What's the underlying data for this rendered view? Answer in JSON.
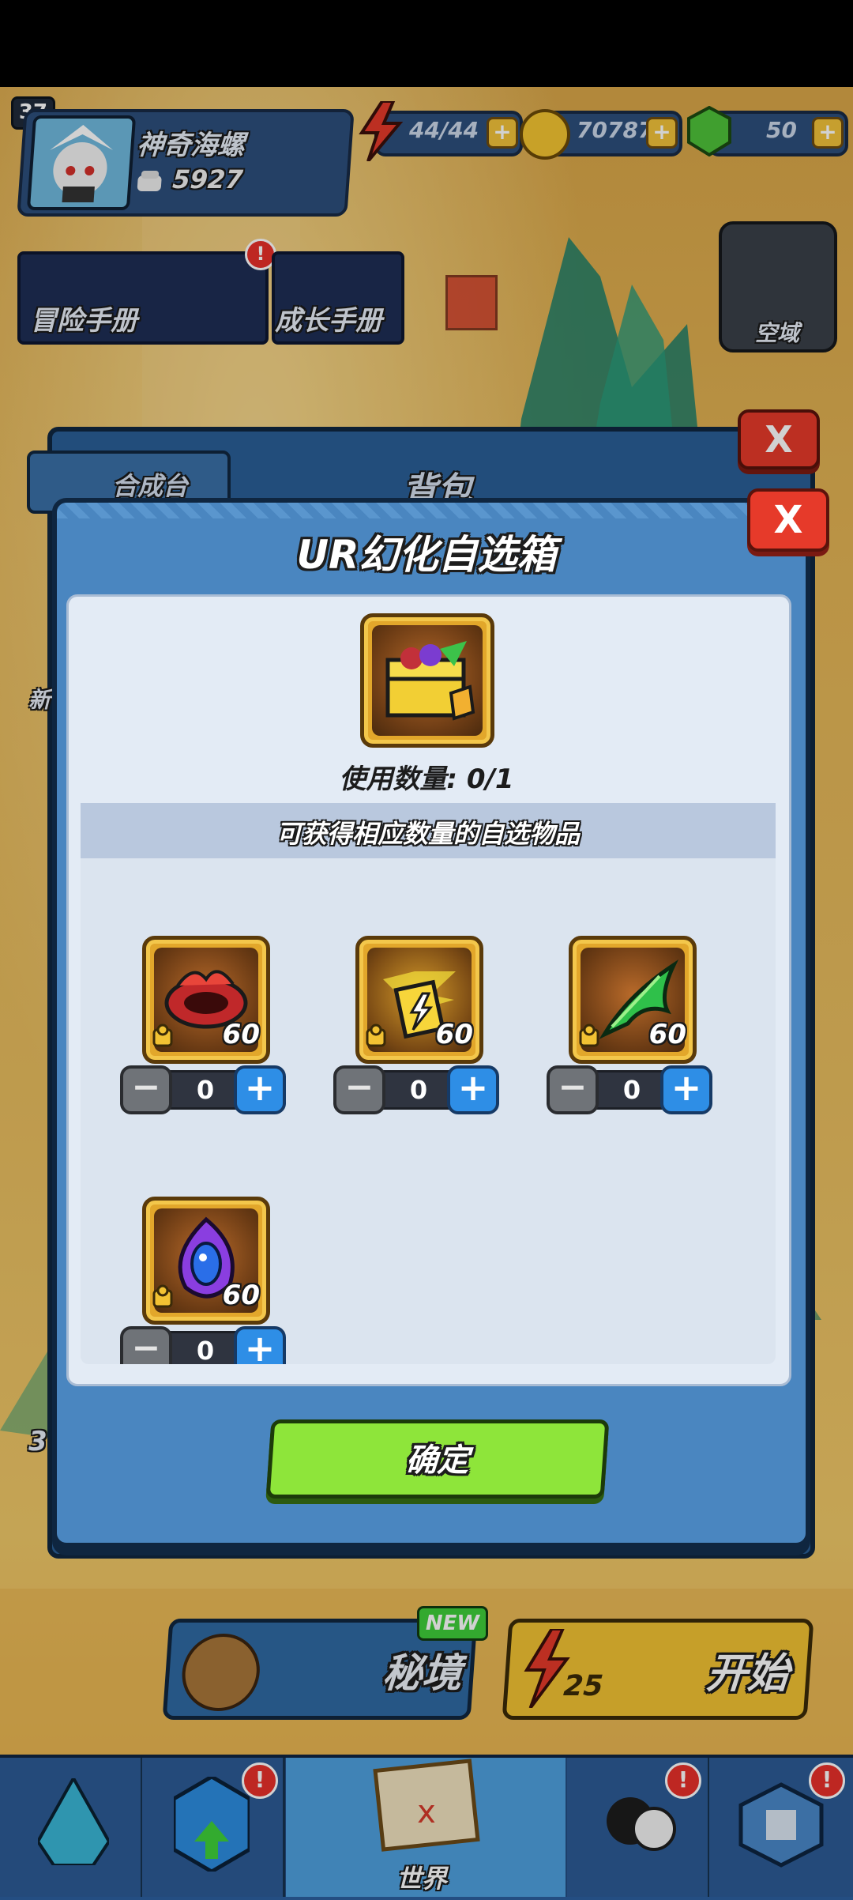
{
  "hud": {
    "level": "37",
    "player_name": "神奇海螺",
    "power": "5927",
    "energy": "44/44",
    "coins": "70787",
    "gems": "50"
  },
  "background": {
    "adventure_manual": "冒险手册",
    "growth_manual": "成长手册",
    "airspace": "空域",
    "crafting": "合成台",
    "bag_title": "背包",
    "secret_realm": "秘境",
    "new_badge": "NEW",
    "start": "开始",
    "stage_cost": "25",
    "world": "世界",
    "side_text_1": "新",
    "side_text_2": "3"
  },
  "dialog": {
    "title": "UR幻化自选箱",
    "use_count_label": "使用数量: 0/1",
    "subtitle": "可获得相应数量的自选物品",
    "items": [
      {
        "name": "crimson-spiked-collar",
        "amount": "60",
        "count": "0"
      },
      {
        "name": "lightning-talisman",
        "amount": "60",
        "count": "0"
      },
      {
        "name": "emerald-wing-blade",
        "amount": "60",
        "count": "0"
      },
      {
        "name": "violet-eye-crystal",
        "amount": "60",
        "count": "0"
      }
    ],
    "confirm": "确定",
    "close": "X"
  },
  "colors": {
    "dialog_header": "#4a86c0",
    "dialog_body": "#dce6f2",
    "confirm_green": "#8ee53a",
    "close_red": "#e63a2a",
    "plus_blue": "#2e8ee6"
  }
}
